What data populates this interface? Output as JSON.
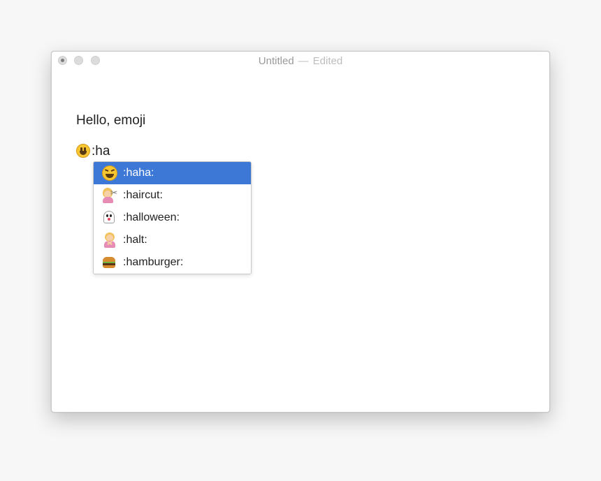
{
  "window": {
    "title": "Untitled",
    "title_separator": "—",
    "status": "Edited"
  },
  "editor": {
    "line1": "Hello, emoji",
    "line2_emoji_icon": "smiley-icon",
    "line2_text": ":ha"
  },
  "autocomplete": {
    "selected_index": 0,
    "items": [
      {
        "icon": "laughing-face-icon",
        "label": ":haha:"
      },
      {
        "icon": "haircut-icon",
        "label": ":haircut:"
      },
      {
        "icon": "ghost-icon",
        "label": ":halloween:"
      },
      {
        "icon": "halt-gesture-icon",
        "label": ":halt:"
      },
      {
        "icon": "hamburger-icon",
        "label": ":hamburger:"
      }
    ]
  },
  "colors": {
    "selection": "#3e78d7",
    "background": "#f7f7f7",
    "window": "#ffffff"
  }
}
